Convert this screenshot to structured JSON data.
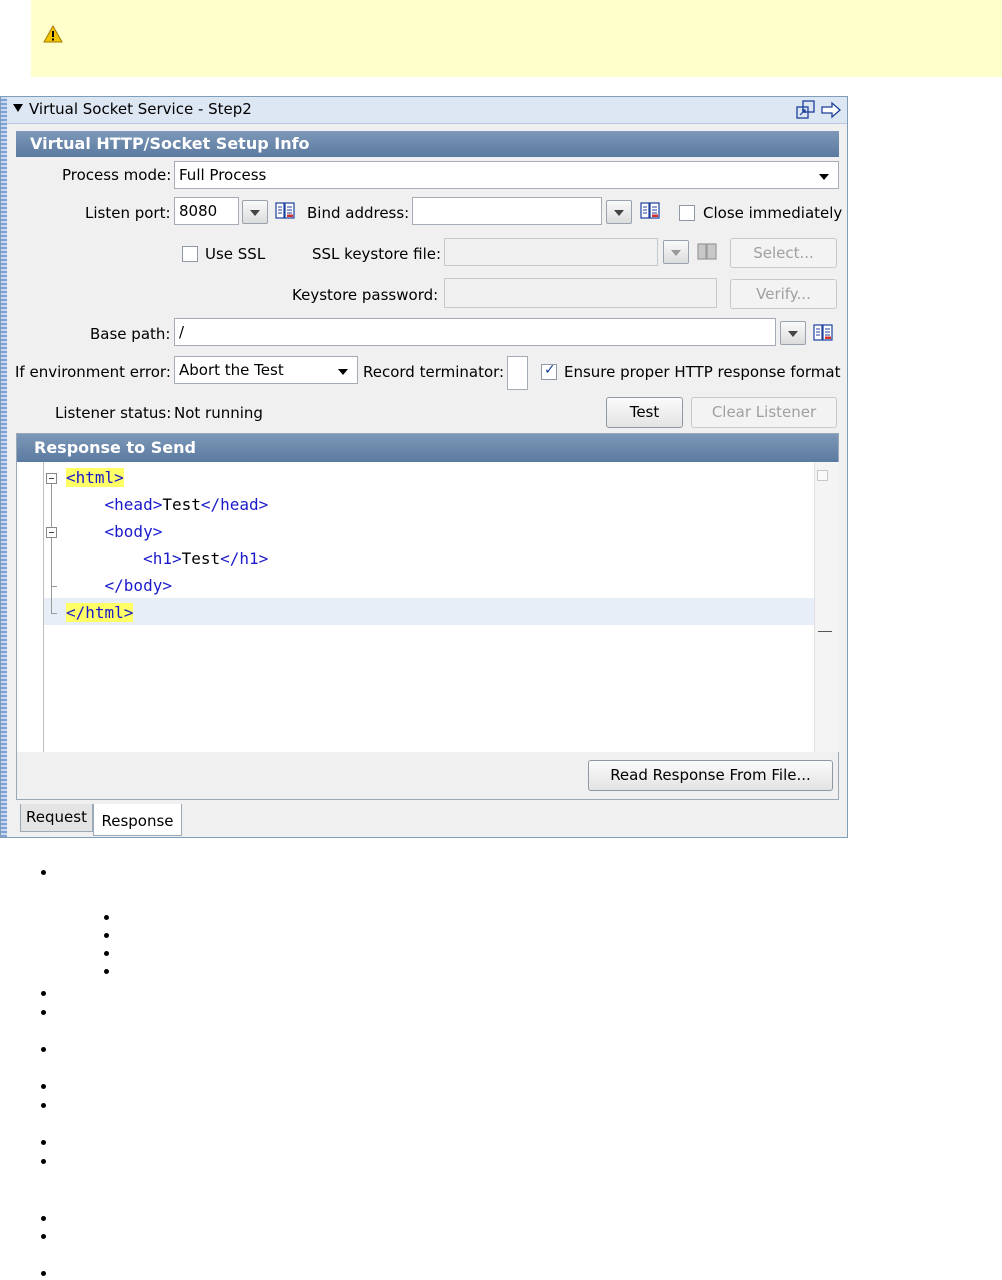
{
  "warning_banner": {
    "icon": "warning-icon"
  },
  "window": {
    "title": "Virtual Socket Service - Step2",
    "icons": [
      "detach-window-icon",
      "forward-arrow-icon"
    ]
  },
  "setup": {
    "heading": "Virtual HTTP/Socket Setup Info",
    "process_mode_label": "Process mode:",
    "process_mode_value": "Full Process",
    "listen_port_label": "Listen port:",
    "listen_port_value": "8080",
    "bind_address_label": "Bind address:",
    "bind_address_value": "",
    "close_immediately_label": "Close immediately",
    "close_immediately_checked": false,
    "use_ssl_label": "Use SSL",
    "use_ssl_checked": false,
    "ssl_keystore_label": "SSL keystore file:",
    "ssl_keystore_value": "",
    "select_button": "Select...",
    "keystore_password_label": "Keystore password:",
    "keystore_password_value": "",
    "verify_button": "Verify...",
    "base_path_label": "Base path:",
    "base_path_value": "/",
    "env_error_label": "If environment error:",
    "env_error_value": "Abort the Test",
    "record_terminator_label": "Record terminator:",
    "record_terminator_value": "",
    "ensure_http_label": "Ensure proper HTTP response format",
    "ensure_http_checked": true,
    "listener_status_label": "Listener status:",
    "listener_status_value": "Not running",
    "test_button": "Test",
    "clear_listener_button": "Clear Listener"
  },
  "response": {
    "heading": "Response to Send",
    "lines": [
      {
        "pre": "",
        "open": "<html>",
        "text": "",
        "close": "",
        "highlight": true
      },
      {
        "pre": "    ",
        "open": "<head>",
        "text": "Test",
        "close": "</head>",
        "highlight": false
      },
      {
        "pre": "    ",
        "open": "<body>",
        "text": "",
        "close": "",
        "highlight": false
      },
      {
        "pre": "        ",
        "open": "<h1>",
        "text": "Test",
        "close": "</h1>",
        "highlight": false
      },
      {
        "pre": "    ",
        "open": "</body>",
        "text": "",
        "close": "",
        "highlight": false
      },
      {
        "pre": "",
        "open": "</html>",
        "text": "",
        "close": "",
        "highlight": true
      }
    ],
    "read_button": "Read Response From File..."
  },
  "tabs": [
    {
      "label": "Request",
      "active": false
    },
    {
      "label": "Response",
      "active": true
    }
  ]
}
